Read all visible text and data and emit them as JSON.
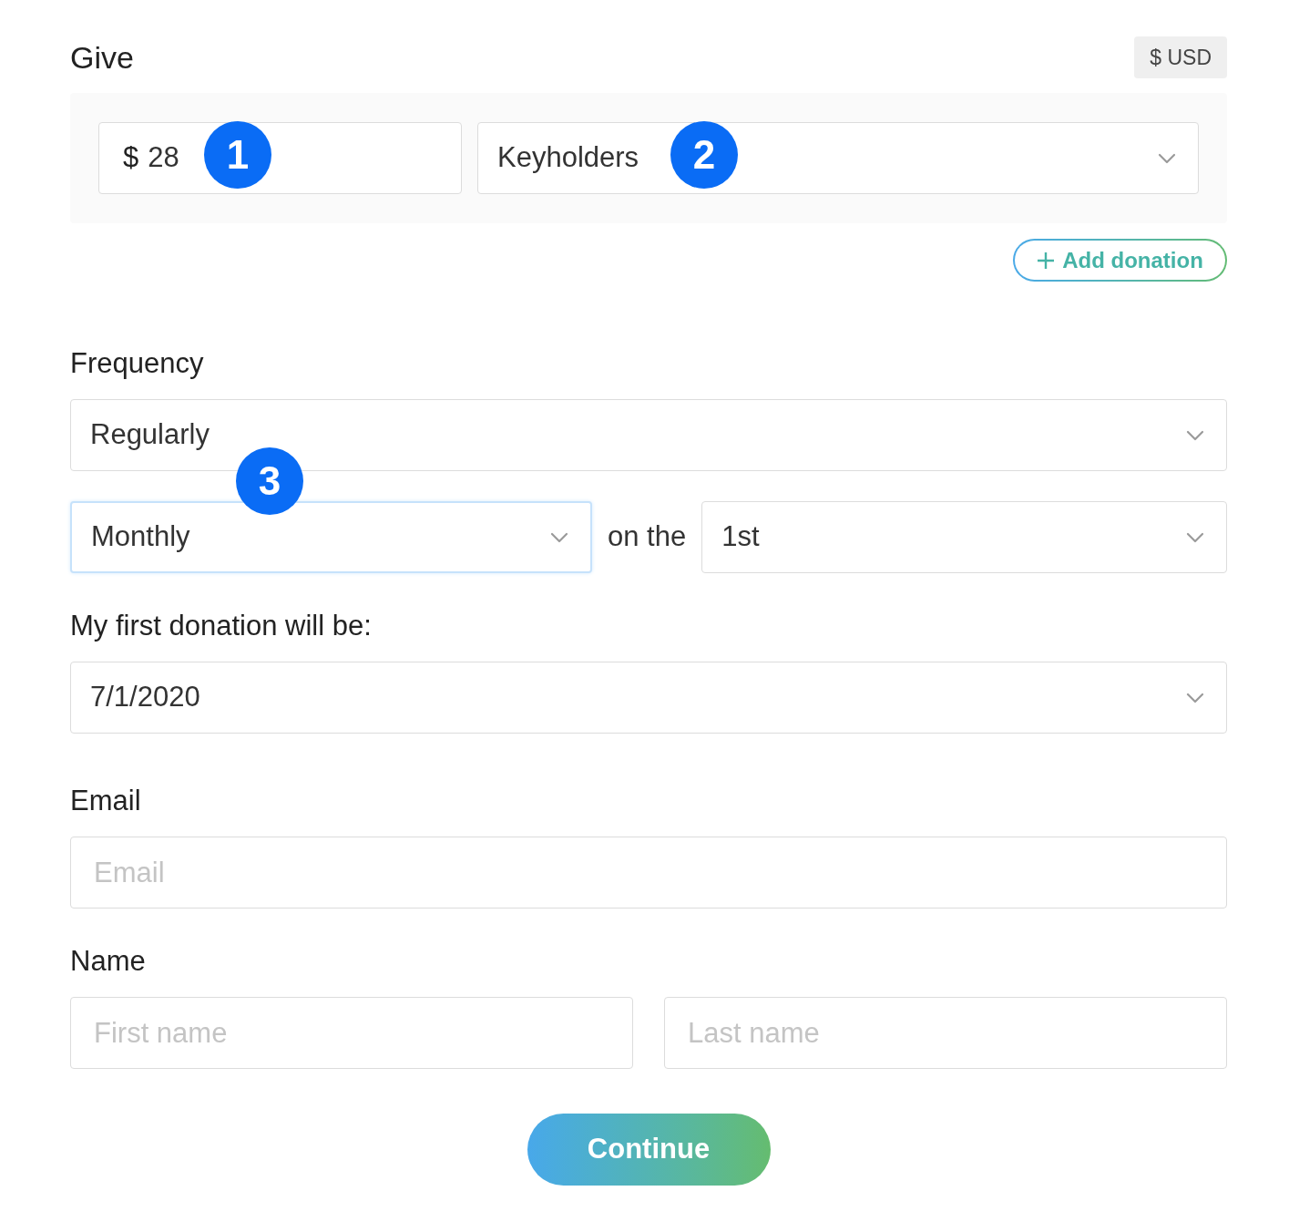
{
  "header": {
    "title": "Give",
    "currency": "$ USD"
  },
  "donations": [
    {
      "currency_symbol": "$",
      "amount": "28",
      "fund": "Keyholders"
    }
  ],
  "add_donation": "Add donation",
  "frequency": {
    "label": "Frequency",
    "value": "Regularly",
    "interval": "Monthly",
    "interval_focused": true,
    "connector": "on the",
    "day": "1st"
  },
  "first_donation": {
    "label": "My first donation will be:",
    "value": "7/1/2020"
  },
  "email": {
    "label": "Email",
    "placeholder": "Email"
  },
  "name": {
    "label": "Name",
    "first_placeholder": "First name",
    "last_placeholder": "Last name"
  },
  "continue_button": "Continue",
  "markers": [
    "1",
    "2",
    "3"
  ]
}
